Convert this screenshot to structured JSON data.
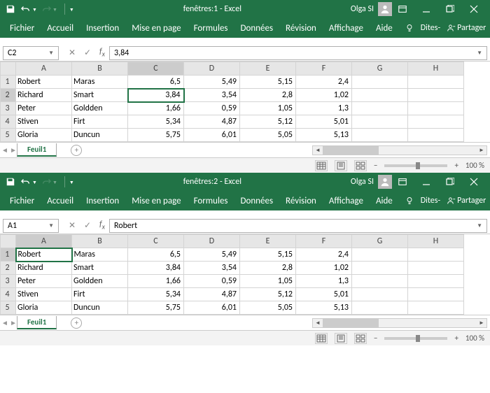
{
  "windows": [
    {
      "title": "fenêtres:1  -  Excel",
      "user": "Olga SI",
      "namebox": "C2",
      "formula": "3,84",
      "selected": {
        "row": 2,
        "col": 3
      }
    },
    {
      "title": "fenêtres:2  -  Excel",
      "user": "Olga SI",
      "namebox": "A1",
      "formula": "Robert",
      "selected": {
        "row": 1,
        "col": 1
      }
    }
  ],
  "ribbon": {
    "items": [
      "Fichier",
      "Accueil",
      "Insertion",
      "Mise en page",
      "Formules",
      "Données",
      "Révision",
      "Affichage",
      "Aide"
    ],
    "tell": "Dites-",
    "share": "Partager"
  },
  "columns": [
    "A",
    "B",
    "C",
    "D",
    "E",
    "F",
    "G",
    "H"
  ],
  "rows": [
    {
      "n": 1,
      "a": "Robert",
      "b": "Maras",
      "c": "6,5",
      "d": "5,49",
      "e": "5,15",
      "f": "2,4"
    },
    {
      "n": 2,
      "a": "Richard",
      "b": "Smart",
      "c": "3,84",
      "d": "3,54",
      "e": "2,8",
      "f": "1,02"
    },
    {
      "n": 3,
      "a": "Peter",
      "b": "Goldden",
      "c": "1,66",
      "d": "0,59",
      "e": "1,05",
      "f": "1,3"
    },
    {
      "n": 4,
      "a": "Stiven",
      "b": "Firt",
      "c": "5,34",
      "d": "4,87",
      "e": "5,12",
      "f": "5,01"
    },
    {
      "n": 5,
      "a": "Gloria",
      "b": "Duncun",
      "c": "5,75",
      "d": "6,01",
      "e": "5,05",
      "f": "5,13"
    }
  ],
  "sheet": "Feuil1",
  "zoom": "100 %"
}
